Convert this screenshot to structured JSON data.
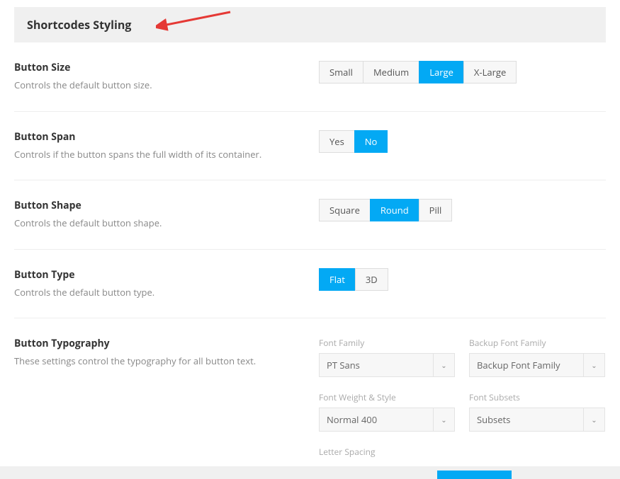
{
  "header": {
    "title": "Shortcodes Styling"
  },
  "sections": {
    "buttonSize": {
      "title": "Button Size",
      "desc": "Controls the default button size.",
      "options": [
        "Small",
        "Medium",
        "Large",
        "X-Large"
      ],
      "selected": "Large"
    },
    "buttonSpan": {
      "title": "Button Span",
      "desc": "Controls if the button spans the full width of its container.",
      "options": [
        "Yes",
        "No"
      ],
      "selected": "No"
    },
    "buttonShape": {
      "title": "Button Shape",
      "desc": "Controls the default button shape.",
      "options": [
        "Square",
        "Round",
        "Pill"
      ],
      "selected": "Round"
    },
    "buttonType": {
      "title": "Button Type",
      "desc": "Controls the default button type.",
      "options": [
        "Flat",
        "3D"
      ],
      "selected": "Flat"
    },
    "typography": {
      "title": "Button Typography",
      "desc": "These settings control the typography for all button text.",
      "fontFamily": {
        "label": "Font Family",
        "value": "PT Sans"
      },
      "backupFontFamily": {
        "label": "Backup Font Family",
        "value": "Backup Font Family"
      },
      "fontWeight": {
        "label": "Font Weight & Style",
        "value": "Normal 400"
      },
      "fontSubsets": {
        "label": "Font Subsets",
        "value": "Subsets"
      },
      "letterSpacing": {
        "label": "Letter Spacing"
      }
    }
  }
}
